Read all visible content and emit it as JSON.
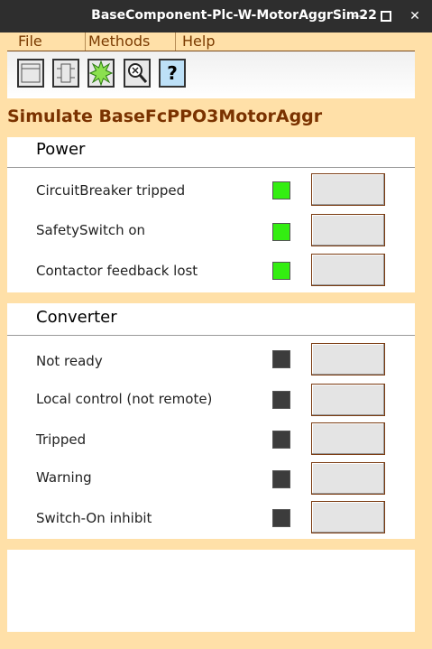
{
  "window": {
    "title": "BaseComponent-Plc-W-MotorAggrSim22",
    "min_glyph": "—",
    "close_glyph": "✕"
  },
  "menu": {
    "file": "File",
    "methods": "Methods",
    "help": "Help"
  },
  "toolbar": {
    "items": [
      {
        "icon": "graph-window-icon"
      },
      {
        "icon": "component-object-icon"
      },
      {
        "icon": "star-burst-icon"
      },
      {
        "icon": "crossref-magnifier-icon"
      },
      {
        "icon": "help-icon",
        "glyph": "?"
      }
    ]
  },
  "heading": "Simulate BaseFcPPO3MotorAggr",
  "colors": {
    "led_on": "#33ee11",
    "led_off": "#3c3c3c",
    "heading": "#7a3200",
    "background": "#ffe0a8"
  },
  "power": {
    "title": "Power",
    "rows": [
      {
        "label": "CircuitBreaker tripped",
        "state": "on"
      },
      {
        "label": "SafetySwitch on",
        "state": "on"
      },
      {
        "label": "Contactor feedback lost",
        "state": "on"
      }
    ]
  },
  "converter": {
    "title": "Converter",
    "rows": [
      {
        "label": "Not ready",
        "state": "off"
      },
      {
        "label": "Local control (not remote)",
        "state": "off"
      },
      {
        "label": "Tripped",
        "state": "off"
      },
      {
        "label": "Warning",
        "state": "off"
      },
      {
        "label": "Switch-On inhibit",
        "state": "off"
      }
    ]
  }
}
